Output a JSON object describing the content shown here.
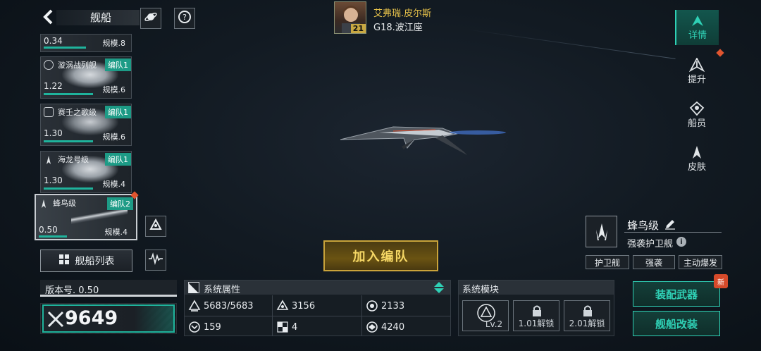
{
  "header": {
    "title": "舰船"
  },
  "captain": {
    "name": "艾弗瑞.皮尔斯",
    "level": "21",
    "location": "G18.波江座"
  },
  "ship_list": [
    {
      "name": "",
      "power": "0.34",
      "scale": "规模.8",
      "fleet": ""
    },
    {
      "name": "漩涡战列舰",
      "power": "1.22",
      "scale": "规模.6",
      "fleet": "编队1"
    },
    {
      "name": "赛壬之歌级",
      "power": "1.30",
      "scale": "规模.6",
      "fleet": "编队1"
    },
    {
      "name": "海龙号级",
      "power": "1.30",
      "scale": "规模.4",
      "fleet": "编队1"
    }
  ],
  "selected_ship_card": {
    "name": "蜂鸟级",
    "power": "0.50",
    "scale": "规模.4",
    "fleet": "编队2"
  },
  "ship_list_button": "舰船列表",
  "version": "版本号. 0.50",
  "combat_power": "9649",
  "join_fleet_button": "加入编队",
  "attributes": {
    "title": "系统属性",
    "values": [
      "5683/5683",
      "3156",
      "2133",
      "159",
      "4",
      "4240"
    ]
  },
  "modules": {
    "title": "系统模块",
    "slots": [
      "Lv.2",
      "1.01解锁",
      "2.01解锁"
    ]
  },
  "right_nav": [
    "详情",
    "提升",
    "船员",
    "皮肤"
  ],
  "ship_info": {
    "name": "蜂鸟级",
    "class": "强袭护卫舰",
    "tags": [
      "护卫舰",
      "强袭",
      "主动爆发"
    ]
  },
  "actions": {
    "equip_weapon": "装配武器",
    "modify_ship": "舰船改装",
    "new_badge": "新"
  },
  "colors": {
    "accent": "#2fd0b5",
    "gold": "#e6c14a",
    "alert": "#e0552f"
  }
}
